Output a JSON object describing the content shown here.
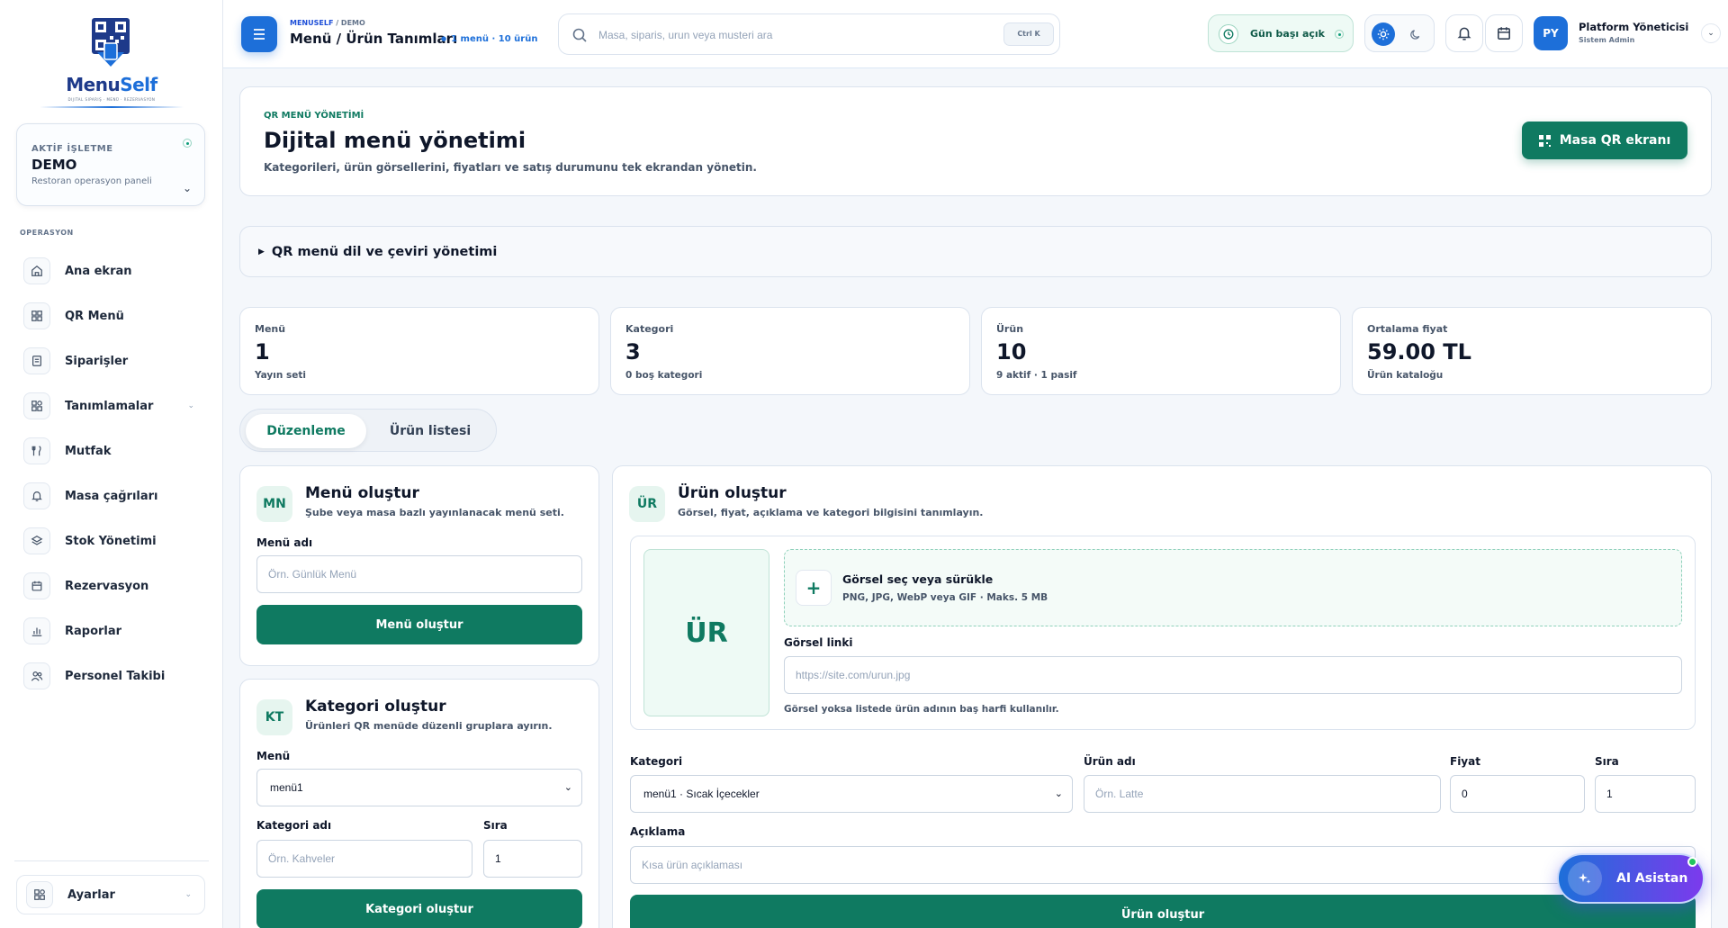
{
  "brand": {
    "name_a": "Menu",
    "name_b": "Self",
    "tagline": "DIJITAL SIPARIŞ · MENÜ · REZERVASYON"
  },
  "business": {
    "label": "AKTİF İŞLETME",
    "name": "DEMO",
    "subtitle": "Restoran operasyon paneli"
  },
  "sidebar": {
    "section": "OPERASYON",
    "items": [
      {
        "label": "Ana ekran",
        "icon": "home-icon"
      },
      {
        "label": "QR Menü",
        "icon": "qr-icon"
      },
      {
        "label": "Siparişler",
        "icon": "receipt-icon"
      },
      {
        "label": "Tanımlamalar",
        "icon": "grid-icon",
        "has_children": true
      },
      {
        "label": "Mutfak",
        "icon": "utensils-icon"
      },
      {
        "label": "Masa çağrıları",
        "icon": "bell-icon"
      },
      {
        "label": "Stok Yönetimi",
        "icon": "layers-icon"
      },
      {
        "label": "Rezervasyon",
        "icon": "calendar-icon"
      },
      {
        "label": "Raporlar",
        "icon": "chart-icon"
      },
      {
        "label": "Personel Takibi",
        "icon": "users-icon"
      }
    ],
    "settings": "Ayarlar"
  },
  "header": {
    "crumb_root": "MENUSELF",
    "crumb_sep": "/",
    "crumb_leaf": "DEMO",
    "title": "Menü / Ürün Tanımları",
    "meta": "1 menü · 10 ürün",
    "search_placeholder": "Masa, siparis, urun veya musteri ara",
    "kbd": "Ctrl K",
    "day_status": "Gün başı açık",
    "user_initials": "PY",
    "user_name": "Platform Yöneticisi",
    "user_role": "Sistem Admin"
  },
  "hero": {
    "kicker": "QR MENÜ YÖNETİMİ",
    "title": "Dijital menü yönetimi",
    "description": "Kategorileri, ürün görsellerini, fiyatları ve satış durumunu tek ekrandan yönetin.",
    "button": "Masa QR ekranı"
  },
  "translate": {
    "label": "QR menü dil ve çeviri yönetimi"
  },
  "stats": [
    {
      "label": "Menü",
      "value": "1",
      "sub": "Yayın seti"
    },
    {
      "label": "Kategori",
      "value": "3",
      "sub": "0 boş kategori"
    },
    {
      "label": "Ürün",
      "value": "10",
      "sub": "9 aktif · 1 pasif"
    },
    {
      "label": "Ortalama fiyat",
      "value": "59.00 TL",
      "sub": "Ürün kataloğu"
    }
  ],
  "tabs": {
    "edit": "Düzenleme",
    "list": "Ürün listesi"
  },
  "menu_form": {
    "badge": "MN",
    "title": "Menü oluştur",
    "subtitle": "Şube veya masa bazlı yayınlanacak menü seti.",
    "name_label": "Menü adı",
    "name_placeholder": "Örn. Günlük Menü",
    "submit": "Menü oluştur"
  },
  "category_form": {
    "badge": "KT",
    "title": "Kategori oluştur",
    "subtitle": "Ürünleri QR menüde düzenli gruplara ayırın.",
    "menu_label": "Menü",
    "menu_value": "menü1",
    "name_label": "Kategori adı",
    "name_placeholder": "Örn. Kahveler",
    "order_label": "Sıra",
    "order_value": "1",
    "submit": "Kategori oluştur"
  },
  "product_form": {
    "badge": "ÜR",
    "title": "Ürün oluştur",
    "subtitle": "Görsel, fiyat, açıklama ve kategori bilgisini tanımlayın.",
    "preview": "ÜR",
    "drop_title": "Görsel seç veya sürükle",
    "drop_sub": "PNG, JPG, WebP veya GIF · Maks. 5 MB",
    "link_label": "Görsel linki",
    "link_placeholder": "https://site.com/urun.jpg",
    "hint": "Görsel yoksa listede ürün adının baş harfi kullanılır.",
    "category_label": "Kategori",
    "category_value": "menü1 · Sıcak İçecekler",
    "name_label": "Ürün adı",
    "name_placeholder": "Örn. Latte",
    "price_label": "Fiyat",
    "price_value": "0",
    "order_label": "Sıra",
    "order_value": "1",
    "desc_label": "Açıklama",
    "desc_placeholder": "Kısa ürün açıklaması",
    "submit": "Ürün oluştur"
  },
  "assistant": {
    "label": "AI Asistan"
  },
  "colors": {
    "primary": "#1d6fd9",
    "accent": "#0f7a61",
    "background": "#f4f7fb"
  }
}
